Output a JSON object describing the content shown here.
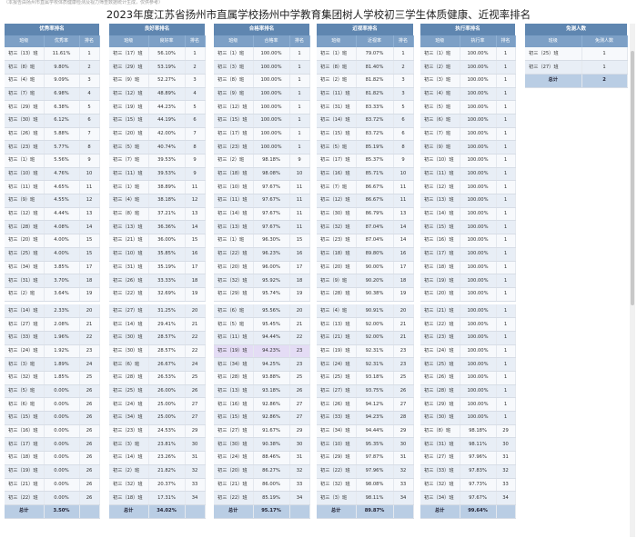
{
  "top_note": "（本报告由扬州市直属学校体质健康检测及视力筛查数据统计生成，仅供参考）",
  "title": "2023年度江苏省扬州市直属学校扬州中学教育集团树人学校初三学生体质健康、近视率排名",
  "tables": [
    {
      "title": "优秀率排名",
      "headers": [
        "班级",
        "优秀率",
        "排名"
      ],
      "rows": [
        [
          "初三（13）班",
          "11.61%",
          "1"
        ],
        [
          "初三（8）班",
          "9.80%",
          "2"
        ],
        [
          "初三（4）班",
          "9.09%",
          "3"
        ],
        [
          "初三（7）班",
          "6.98%",
          "4"
        ],
        [
          "初三（29）班",
          "6.38%",
          "5"
        ],
        [
          "初三（30）班",
          "6.12%",
          "6"
        ],
        [
          "初三（26）班",
          "5.88%",
          "7"
        ],
        [
          "初三（23）班",
          "5.77%",
          "8"
        ],
        [
          "初三（1）班",
          "5.56%",
          "9"
        ],
        [
          "初三（10）班",
          "4.76%",
          "10"
        ],
        [
          "初三（11）班",
          "4.65%",
          "11"
        ],
        [
          "初三（9）班",
          "4.55%",
          "12"
        ],
        [
          "初三（12）班",
          "4.44%",
          "13"
        ],
        [
          "初三（28）班",
          "4.08%",
          "14"
        ],
        [
          "初三（20）班",
          "4.00%",
          "15"
        ],
        [
          "初三（25）班",
          "4.00%",
          "15"
        ],
        [
          "初三（34）班",
          "3.85%",
          "17"
        ],
        [
          "初三（31）班",
          "3.70%",
          "18"
        ],
        [
          "初三（2）班",
          "3.64%",
          "19"
        ],
        [
          "初三（14）班",
          "2.33%",
          "20"
        ],
        [
          "初三（27）班",
          "2.08%",
          "21"
        ],
        [
          "初三（33）班",
          "1.96%",
          "22"
        ],
        [
          "初三（24）班",
          "1.92%",
          "23"
        ],
        [
          "初三（3）班",
          "1.89%",
          "24"
        ],
        [
          "初三（32）班",
          "1.85%",
          "25"
        ],
        [
          "初三（5）班",
          "0.00%",
          "26"
        ],
        [
          "初三（6）班",
          "0.00%",
          "26"
        ],
        [
          "初三（15）班",
          "0.00%",
          "26"
        ],
        [
          "初三（16）班",
          "0.00%",
          "26"
        ],
        [
          "初三（17）班",
          "0.00%",
          "26"
        ],
        [
          "初三（18）班",
          "0.00%",
          "26"
        ],
        [
          "初三（19）班",
          "0.00%",
          "26"
        ],
        [
          "初三（21）班",
          "0.00%",
          "26"
        ],
        [
          "初三（22）班",
          "0.00%",
          "26"
        ]
      ],
      "total": [
        "总计",
        "3.50%",
        ""
      ]
    },
    {
      "title": "良好率排名",
      "headers": [
        "班级",
        "良好率",
        "排名"
      ],
      "rows": [
        [
          "初三（17）班",
          "56.10%",
          "1"
        ],
        [
          "初三（29）班",
          "53.19%",
          "2"
        ],
        [
          "初三（9）班",
          "52.27%",
          "3"
        ],
        [
          "初三（12）班",
          "48.89%",
          "4"
        ],
        [
          "初三（19）班",
          "44.23%",
          "5"
        ],
        [
          "初三（15）班",
          "44.19%",
          "6"
        ],
        [
          "初三（20）班",
          "42.00%",
          "7"
        ],
        [
          "初三（5）班",
          "40.74%",
          "8"
        ],
        [
          "初三（7）班",
          "39.53%",
          "9"
        ],
        [
          "初三（11）班",
          "39.53%",
          "9"
        ],
        [
          "初三（1）班",
          "38.89%",
          "11"
        ],
        [
          "初三（4）班",
          "38.18%",
          "12"
        ],
        [
          "初三（8）班",
          "37.21%",
          "13"
        ],
        [
          "初三（13）班",
          "36.36%",
          "14"
        ],
        [
          "初三（21）班",
          "36.00%",
          "15"
        ],
        [
          "初三（10）班",
          "35.85%",
          "16"
        ],
        [
          "初三（31）班",
          "35.19%",
          "17"
        ],
        [
          "初三（26）班",
          "33.33%",
          "18"
        ],
        [
          "初三（22）班",
          "32.69%",
          "19"
        ],
        [
          "初三（27）班",
          "31.25%",
          "20"
        ],
        [
          "初三（14）班",
          "29.41%",
          "21"
        ],
        [
          "初三（30）班",
          "28.57%",
          "22"
        ],
        [
          "初三（30）班",
          "28.57%",
          "22"
        ],
        [
          "初三（6）班",
          "26.67%",
          "24"
        ],
        [
          "初三（28）班",
          "26.53%",
          "25"
        ],
        [
          "初三（25）班",
          "26.00%",
          "26"
        ],
        [
          "初三（24）班",
          "25.00%",
          "27"
        ],
        [
          "初三（34）班",
          "25.00%",
          "27"
        ],
        [
          "初三（23）班",
          "24.53%",
          "29"
        ],
        [
          "初三（3）班",
          "23.81%",
          "30"
        ],
        [
          "初三（14）班",
          "23.26%",
          "31"
        ],
        [
          "初三（2）班",
          "21.82%",
          "32"
        ],
        [
          "初三（32）班",
          "20.37%",
          "33"
        ],
        [
          "初三（18）班",
          "17.31%",
          "34"
        ]
      ],
      "total": [
        "总计",
        "34.02%",
        ""
      ]
    },
    {
      "title": "合格率排名",
      "headers": [
        "班级",
        "合格率",
        "排名"
      ],
      "rows": [
        [
          "初三（1）班",
          "100.00%",
          "1"
        ],
        [
          "初三（3）班",
          "100.00%",
          "1"
        ],
        [
          "初三（8）班",
          "100.00%",
          "1"
        ],
        [
          "初三（9）班",
          "100.00%",
          "1"
        ],
        [
          "初三（12）班",
          "100.00%",
          "1"
        ],
        [
          "初三（15）班",
          "100.00%",
          "1"
        ],
        [
          "初三（17）班",
          "100.00%",
          "1"
        ],
        [
          "初三（23）班",
          "100.00%",
          "1"
        ],
        [
          "初三（2）班",
          "98.18%",
          "9"
        ],
        [
          "初三（18）班",
          "98.08%",
          "10"
        ],
        [
          "初三（10）班",
          "97.67%",
          "11"
        ],
        [
          "初三（11）班",
          "97.67%",
          "11"
        ],
        [
          "初三（14）班",
          "97.67%",
          "11"
        ],
        [
          "初三（13）班",
          "97.67%",
          "11"
        ],
        [
          "初三（1）班",
          "96.30%",
          "15"
        ],
        [
          "初三（22）班",
          "96.23%",
          "16"
        ],
        [
          "初三（20）班",
          "96.00%",
          "17"
        ],
        [
          "初三（32）班",
          "95.92%",
          "18"
        ],
        [
          "初三（29）班",
          "95.74%",
          "19"
        ],
        [
          "初三（6）班",
          "95.56%",
          "20"
        ],
        [
          "初三（5）班",
          "95.45%",
          "21"
        ],
        [
          "初三（11）班",
          "94.44%",
          "22"
        ],
        [
          "初三（19）班",
          "94.23%",
          "23"
        ],
        [
          "初三（34）班",
          "94.25%",
          "23"
        ],
        [
          "初三（28）班",
          "93.88%",
          "25"
        ],
        [
          "初三（13）班",
          "93.18%",
          "26"
        ],
        [
          "初三（16）班",
          "92.86%",
          "27"
        ],
        [
          "初三（15）班",
          "92.86%",
          "27"
        ],
        [
          "初三（27）班",
          "91.67%",
          "29"
        ],
        [
          "初三（30）班",
          "90.38%",
          "30"
        ],
        [
          "初三（24）班",
          "88.46%",
          "31"
        ],
        [
          "初三（20）班",
          "86.27%",
          "32"
        ],
        [
          "初三（21）班",
          "86.00%",
          "33"
        ],
        [
          "初三（22）班",
          "85.19%",
          "34"
        ]
      ],
      "total": [
        "总计",
        "95.17%",
        ""
      ]
    },
    {
      "title": "近视率排名",
      "headers": [
        "班级",
        "近视率",
        "排名"
      ],
      "rows": [
        [
          "初三（1）班",
          "79.07%",
          "1"
        ],
        [
          "初三（8）班",
          "81.40%",
          "2"
        ],
        [
          "初三（2）班",
          "81.82%",
          "3"
        ],
        [
          "初三（11）班",
          "81.82%",
          "3"
        ],
        [
          "初三（31）班",
          "83.33%",
          "5"
        ],
        [
          "初三（14）班",
          "83.72%",
          "6"
        ],
        [
          "初三（15）班",
          "83.72%",
          "6"
        ],
        [
          "初三（5）班",
          "85.19%",
          "8"
        ],
        [
          "初三（17）班",
          "85.37%",
          "9"
        ],
        [
          "初三（16）班",
          "85.71%",
          "10"
        ],
        [
          "初三（7）班",
          "86.67%",
          "11"
        ],
        [
          "初三（12）班",
          "86.67%",
          "11"
        ],
        [
          "初三（30）班",
          "86.79%",
          "13"
        ],
        [
          "初三（32）班",
          "87.04%",
          "14"
        ],
        [
          "初三（23）班",
          "87.04%",
          "14"
        ],
        [
          "初三（18）班",
          "89.80%",
          "16"
        ],
        [
          "初三（20）班",
          "90.00%",
          "17"
        ],
        [
          "初三（9）班",
          "90.20%",
          "18"
        ],
        [
          "初三（28）班",
          "90.38%",
          "19"
        ],
        [
          "初三（4）班",
          "90.91%",
          "20"
        ],
        [
          "初三（13）班",
          "92.00%",
          "21"
        ],
        [
          "初三（21）班",
          "92.00%",
          "21"
        ],
        [
          "初三（19）班",
          "92.31%",
          "23"
        ],
        [
          "初三（24）班",
          "92.31%",
          "23"
        ],
        [
          "初三（25）班",
          "93.18%",
          "25"
        ],
        [
          "初三（27）班",
          "93.75%",
          "26"
        ],
        [
          "初三（26）班",
          "94.12%",
          "27"
        ],
        [
          "初三（33）班",
          "94.23%",
          "28"
        ],
        [
          "初三（34）班",
          "94.44%",
          "29"
        ],
        [
          "初三（10）班",
          "95.35%",
          "30"
        ],
        [
          "初三（29）班",
          "97.87%",
          "31"
        ],
        [
          "初三（22）班",
          "97.96%",
          "32"
        ],
        [
          "初三（32）班",
          "98.08%",
          "33"
        ],
        [
          "初三（3）班",
          "98.11%",
          "34"
        ]
      ],
      "total": [
        "总计",
        "89.87%",
        ""
      ]
    },
    {
      "title": "执行率排名",
      "headers": [
        "班级",
        "执行率",
        "排名"
      ],
      "rows": [
        [
          "初三（1）班",
          "100.00%",
          "1"
        ],
        [
          "初三（2）班",
          "100.00%",
          "1"
        ],
        [
          "初三（3）班",
          "100.00%",
          "1"
        ],
        [
          "初三（4）班",
          "100.00%",
          "1"
        ],
        [
          "初三（5）班",
          "100.00%",
          "1"
        ],
        [
          "初三（6）班",
          "100.00%",
          "1"
        ],
        [
          "初三（7）班",
          "100.00%",
          "1"
        ],
        [
          "初三（9）班",
          "100.00%",
          "1"
        ],
        [
          "初三（10）班",
          "100.00%",
          "1"
        ],
        [
          "初三（11）班",
          "100.00%",
          "1"
        ],
        [
          "初三（12）班",
          "100.00%",
          "1"
        ],
        [
          "初三（13）班",
          "100.00%",
          "1"
        ],
        [
          "初三（14）班",
          "100.00%",
          "1"
        ],
        [
          "初三（15）班",
          "100.00%",
          "1"
        ],
        [
          "初三（16）班",
          "100.00%",
          "1"
        ],
        [
          "初三（17）班",
          "100.00%",
          "1"
        ],
        [
          "初三（18）班",
          "100.00%",
          "1"
        ],
        [
          "初三（19）班",
          "100.00%",
          "1"
        ],
        [
          "初三（20）班",
          "100.00%",
          "1"
        ],
        [
          "初三（21）班",
          "100.00%",
          "1"
        ],
        [
          "初三（22）班",
          "100.00%",
          "1"
        ],
        [
          "初三（23）班",
          "100.00%",
          "1"
        ],
        [
          "初三（24）班",
          "100.00%",
          "1"
        ],
        [
          "初三（25）班",
          "100.00%",
          "1"
        ],
        [
          "初三（26）班",
          "100.00%",
          "1"
        ],
        [
          "初三（28）班",
          "100.00%",
          "1"
        ],
        [
          "初三（29）班",
          "100.00%",
          "1"
        ],
        [
          "初三（30）班",
          "100.00%",
          "1"
        ],
        [
          "初三（8）班",
          "98.18%",
          "29"
        ],
        [
          "初三（31）班",
          "98.11%",
          "30"
        ],
        [
          "初三（27）班",
          "97.96%",
          "31"
        ],
        [
          "初三（33）班",
          "97.83%",
          "32"
        ],
        [
          "初三（32）班",
          "97.73%",
          "33"
        ],
        [
          "初三（34）班",
          "97.67%",
          "34"
        ]
      ],
      "total": [
        "总计",
        "99.64%",
        ""
      ]
    },
    {
      "title": "免测人数",
      "headers": [
        "班级",
        "免测人数"
      ],
      "rows": [
        [
          "初三（25）班",
          "1"
        ],
        [
          "初三（27）班",
          "1"
        ]
      ],
      "total": [
        "总计",
        "2"
      ]
    }
  ]
}
